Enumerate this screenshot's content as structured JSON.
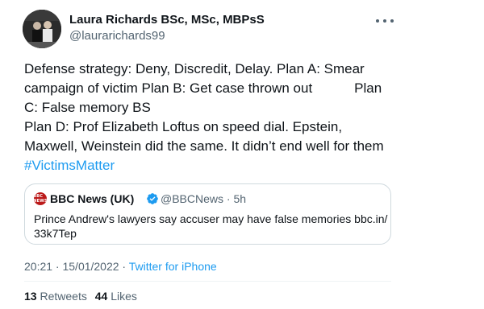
{
  "author": {
    "name": "Laura Richards BSc, MSc, MBPsS",
    "handle": "@laurarichards99"
  },
  "tweet": {
    "lines": [
      "Defense strategy: Deny, Discredit, Delay. Plan A: Smear",
      "campaign of victim Plan B: Get case thrown out           Plan",
      "C: False memory BS",
      "Plan D: Prof Elizabeth Loftus on speed dial. Epstein,",
      "Maxwell, Weinstein did the same. It didn’t end well for them"
    ],
    "hashtag": "#VictimsMatter"
  },
  "quote": {
    "logo_text": "BBC NEWS",
    "name": "BBC News (UK)",
    "meta": "@BBCNews · 5h",
    "lines": [
      "Prince Andrew's lawyers say accuser may have false memories bbc.in/",
      "33k7Tep"
    ]
  },
  "meta": {
    "timestamp": "20:21 · 15/01/2022 · ",
    "source": "Twitter for iPhone"
  },
  "stats": {
    "retweets_count": "13",
    "retweets_label": "Retweets",
    "likes_count": "44",
    "likes_label": "Likes"
  },
  "colors": {
    "accent": "#1d9bf0",
    "text": "#0f1419",
    "secondary": "#536471",
    "border": "#cfd9de",
    "bbc_red": "#bb1919"
  },
  "icons": {
    "more": "more-horizontal-icon",
    "verified": "verified-badge-icon"
  }
}
